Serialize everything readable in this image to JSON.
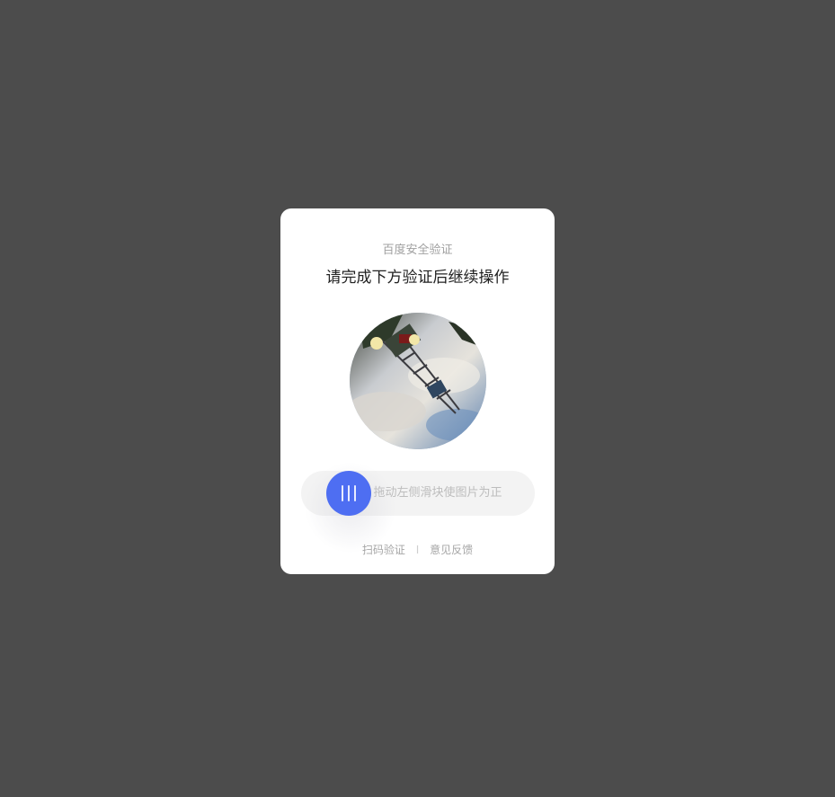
{
  "dialog": {
    "brand": "百度安全验证",
    "headline": "请完成下方验证后继续操作"
  },
  "captcha": {
    "image_icon": "rotated-photo",
    "slider_hint": "拖动左侧滑块使图片为正",
    "knob_icon": "drag-handle-icon",
    "accent_color": "#4e6ef2"
  },
  "footer": {
    "scan_label": "扫码验证",
    "separator": "I",
    "feedback_label": "意见反馈"
  }
}
